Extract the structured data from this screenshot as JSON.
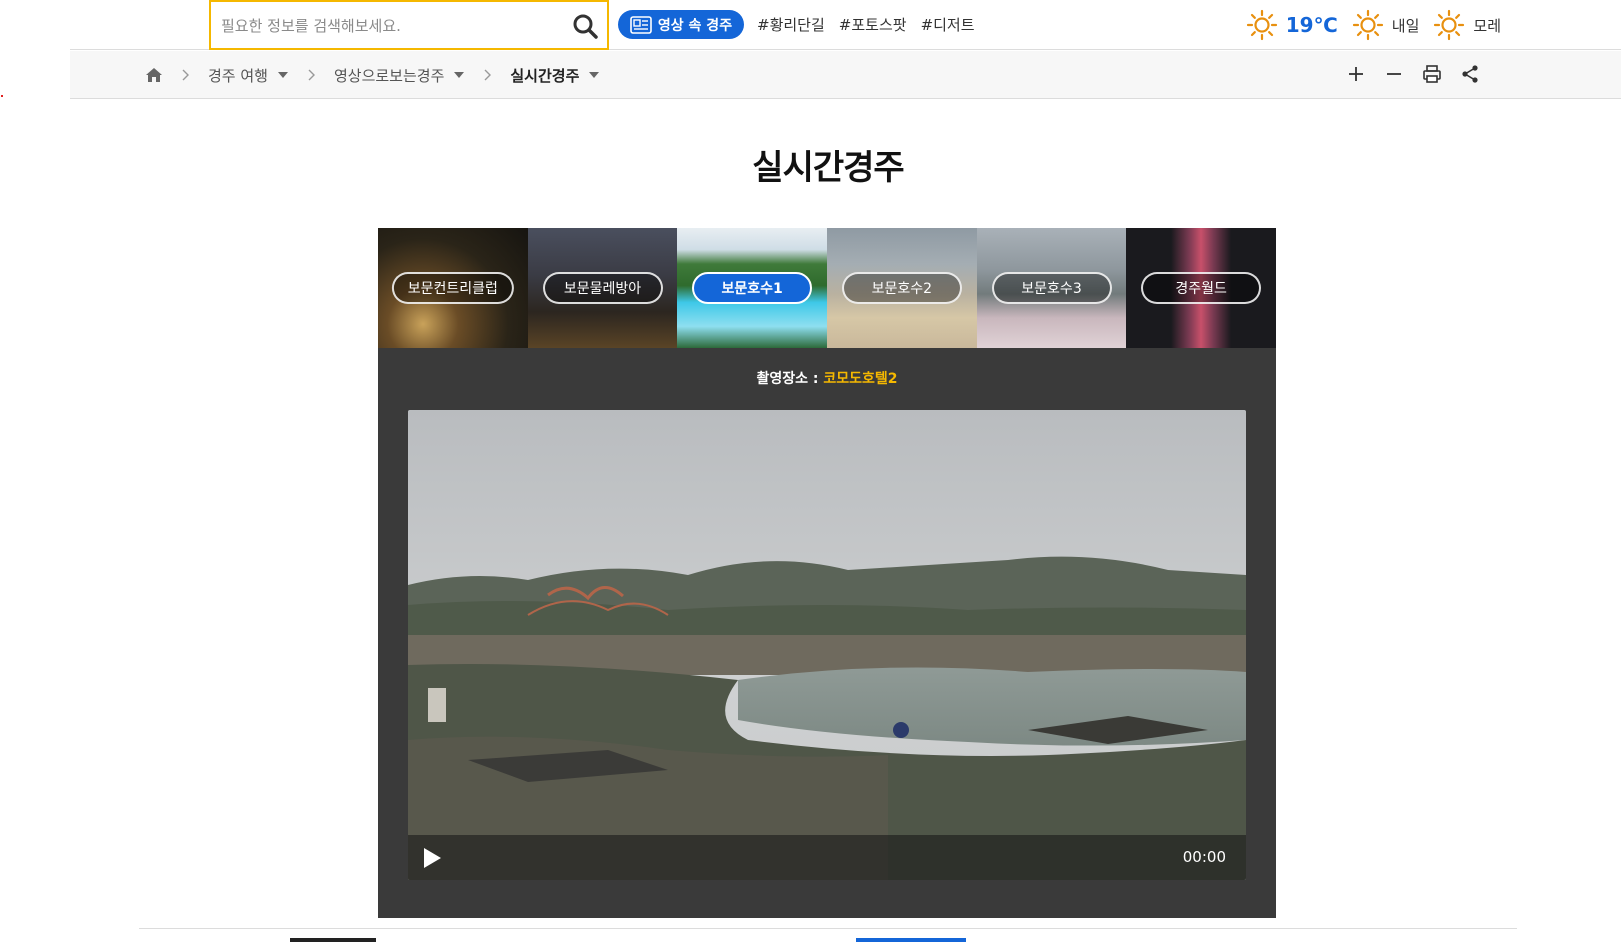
{
  "search": {
    "placeholder": "필요한 정보를 검색해보세요."
  },
  "header": {
    "video_pill_label": "영상 속 경주",
    "hashtags": [
      "#황리단길",
      "#포토스팟",
      "#디저트"
    ],
    "weather": {
      "today_temp": "19℃",
      "tomorrow_label": "내일",
      "day_after_label": "모레",
      "sun_color": "#e8900f"
    }
  },
  "breadcrumb": {
    "items": [
      "경주 여행",
      "영상으로보는경주",
      "실시간경주"
    ]
  },
  "tools": [
    "zoom-in",
    "zoom-out",
    "print",
    "share"
  ],
  "page_title": "실시간경주",
  "cameras": [
    {
      "label": "보문컨트리클럽",
      "active": false
    },
    {
      "label": "보문물레방아",
      "active": false
    },
    {
      "label": "보문호수1",
      "active": true
    },
    {
      "label": "보문호수2",
      "active": false
    },
    {
      "label": "보문호수3",
      "active": false
    },
    {
      "label": "경주월드",
      "active": false
    }
  ],
  "location": {
    "prefix": "촬영장소 : ",
    "name": "코모도호텔2"
  },
  "player": {
    "time": "00:00"
  },
  "colors": {
    "accent": "#1466d8",
    "highlight": "#f5b800",
    "panel": "#3a3a3a"
  }
}
